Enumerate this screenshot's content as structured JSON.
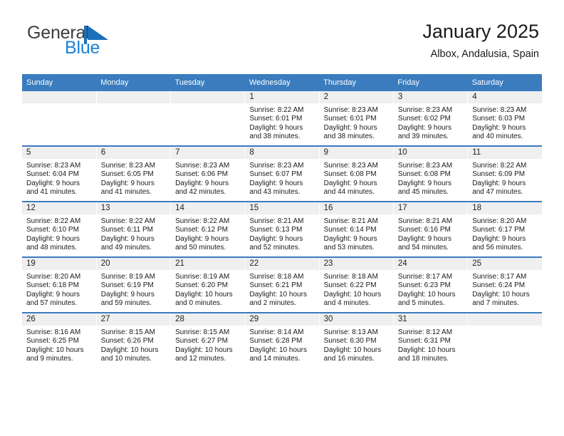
{
  "brand": {
    "name_part1": "General",
    "name_part2": "Blue",
    "flag_icon": "blue-flag-triangle",
    "accent_color": "#1c7fd4"
  },
  "header": {
    "title": "January 2025",
    "location": "Albox, Andalusia, Spain"
  },
  "theme": {
    "header_row_color": "#3a7cbe",
    "daynum_band_color": "#efefef",
    "text_color": "#1a1a1a"
  },
  "weekday_headers": [
    "Sunday",
    "Monday",
    "Tuesday",
    "Wednesday",
    "Thursday",
    "Friday",
    "Saturday"
  ],
  "weeks": [
    [
      {
        "day": "",
        "empty": true,
        "sunrise": "",
        "sunset": "",
        "daylight_line1": "",
        "daylight_line2": ""
      },
      {
        "day": "",
        "empty": true,
        "sunrise": "",
        "sunset": "",
        "daylight_line1": "",
        "daylight_line2": ""
      },
      {
        "day": "",
        "empty": true,
        "sunrise": "",
        "sunset": "",
        "daylight_line1": "",
        "daylight_line2": ""
      },
      {
        "day": "1",
        "empty": false,
        "sunrise": "Sunrise: 8:22 AM",
        "sunset": "Sunset: 6:01 PM",
        "daylight_line1": "Daylight: 9 hours",
        "daylight_line2": "and 38 minutes."
      },
      {
        "day": "2",
        "empty": false,
        "sunrise": "Sunrise: 8:23 AM",
        "sunset": "Sunset: 6:01 PM",
        "daylight_line1": "Daylight: 9 hours",
        "daylight_line2": "and 38 minutes."
      },
      {
        "day": "3",
        "empty": false,
        "sunrise": "Sunrise: 8:23 AM",
        "sunset": "Sunset: 6:02 PM",
        "daylight_line1": "Daylight: 9 hours",
        "daylight_line2": "and 39 minutes."
      },
      {
        "day": "4",
        "empty": false,
        "sunrise": "Sunrise: 8:23 AM",
        "sunset": "Sunset: 6:03 PM",
        "daylight_line1": "Daylight: 9 hours",
        "daylight_line2": "and 40 minutes."
      }
    ],
    [
      {
        "day": "5",
        "empty": false,
        "sunrise": "Sunrise: 8:23 AM",
        "sunset": "Sunset: 6:04 PM",
        "daylight_line1": "Daylight: 9 hours",
        "daylight_line2": "and 41 minutes."
      },
      {
        "day": "6",
        "empty": false,
        "sunrise": "Sunrise: 8:23 AM",
        "sunset": "Sunset: 6:05 PM",
        "daylight_line1": "Daylight: 9 hours",
        "daylight_line2": "and 41 minutes."
      },
      {
        "day": "7",
        "empty": false,
        "sunrise": "Sunrise: 8:23 AM",
        "sunset": "Sunset: 6:06 PM",
        "daylight_line1": "Daylight: 9 hours",
        "daylight_line2": "and 42 minutes."
      },
      {
        "day": "8",
        "empty": false,
        "sunrise": "Sunrise: 8:23 AM",
        "sunset": "Sunset: 6:07 PM",
        "daylight_line1": "Daylight: 9 hours",
        "daylight_line2": "and 43 minutes."
      },
      {
        "day": "9",
        "empty": false,
        "sunrise": "Sunrise: 8:23 AM",
        "sunset": "Sunset: 6:08 PM",
        "daylight_line1": "Daylight: 9 hours",
        "daylight_line2": "and 44 minutes."
      },
      {
        "day": "10",
        "empty": false,
        "sunrise": "Sunrise: 8:23 AM",
        "sunset": "Sunset: 6:08 PM",
        "daylight_line1": "Daylight: 9 hours",
        "daylight_line2": "and 45 minutes."
      },
      {
        "day": "11",
        "empty": false,
        "sunrise": "Sunrise: 8:22 AM",
        "sunset": "Sunset: 6:09 PM",
        "daylight_line1": "Daylight: 9 hours",
        "daylight_line2": "and 47 minutes."
      }
    ],
    [
      {
        "day": "12",
        "empty": false,
        "sunrise": "Sunrise: 8:22 AM",
        "sunset": "Sunset: 6:10 PM",
        "daylight_line1": "Daylight: 9 hours",
        "daylight_line2": "and 48 minutes."
      },
      {
        "day": "13",
        "empty": false,
        "sunrise": "Sunrise: 8:22 AM",
        "sunset": "Sunset: 6:11 PM",
        "daylight_line1": "Daylight: 9 hours",
        "daylight_line2": "and 49 minutes."
      },
      {
        "day": "14",
        "empty": false,
        "sunrise": "Sunrise: 8:22 AM",
        "sunset": "Sunset: 6:12 PM",
        "daylight_line1": "Daylight: 9 hours",
        "daylight_line2": "and 50 minutes."
      },
      {
        "day": "15",
        "empty": false,
        "sunrise": "Sunrise: 8:21 AM",
        "sunset": "Sunset: 6:13 PM",
        "daylight_line1": "Daylight: 9 hours",
        "daylight_line2": "and 52 minutes."
      },
      {
        "day": "16",
        "empty": false,
        "sunrise": "Sunrise: 8:21 AM",
        "sunset": "Sunset: 6:14 PM",
        "daylight_line1": "Daylight: 9 hours",
        "daylight_line2": "and 53 minutes."
      },
      {
        "day": "17",
        "empty": false,
        "sunrise": "Sunrise: 8:21 AM",
        "sunset": "Sunset: 6:16 PM",
        "daylight_line1": "Daylight: 9 hours",
        "daylight_line2": "and 54 minutes."
      },
      {
        "day": "18",
        "empty": false,
        "sunrise": "Sunrise: 8:20 AM",
        "sunset": "Sunset: 6:17 PM",
        "daylight_line1": "Daylight: 9 hours",
        "daylight_line2": "and 56 minutes."
      }
    ],
    [
      {
        "day": "19",
        "empty": false,
        "sunrise": "Sunrise: 8:20 AM",
        "sunset": "Sunset: 6:18 PM",
        "daylight_line1": "Daylight: 9 hours",
        "daylight_line2": "and 57 minutes."
      },
      {
        "day": "20",
        "empty": false,
        "sunrise": "Sunrise: 8:19 AM",
        "sunset": "Sunset: 6:19 PM",
        "daylight_line1": "Daylight: 9 hours",
        "daylight_line2": "and 59 minutes."
      },
      {
        "day": "21",
        "empty": false,
        "sunrise": "Sunrise: 8:19 AM",
        "sunset": "Sunset: 6:20 PM",
        "daylight_line1": "Daylight: 10 hours",
        "daylight_line2": "and 0 minutes."
      },
      {
        "day": "22",
        "empty": false,
        "sunrise": "Sunrise: 8:18 AM",
        "sunset": "Sunset: 6:21 PM",
        "daylight_line1": "Daylight: 10 hours",
        "daylight_line2": "and 2 minutes."
      },
      {
        "day": "23",
        "empty": false,
        "sunrise": "Sunrise: 8:18 AM",
        "sunset": "Sunset: 6:22 PM",
        "daylight_line1": "Daylight: 10 hours",
        "daylight_line2": "and 4 minutes."
      },
      {
        "day": "24",
        "empty": false,
        "sunrise": "Sunrise: 8:17 AM",
        "sunset": "Sunset: 6:23 PM",
        "daylight_line1": "Daylight: 10 hours",
        "daylight_line2": "and 5 minutes."
      },
      {
        "day": "25",
        "empty": false,
        "sunrise": "Sunrise: 8:17 AM",
        "sunset": "Sunset: 6:24 PM",
        "daylight_line1": "Daylight: 10 hours",
        "daylight_line2": "and 7 minutes."
      }
    ],
    [
      {
        "day": "26",
        "empty": false,
        "sunrise": "Sunrise: 8:16 AM",
        "sunset": "Sunset: 6:25 PM",
        "daylight_line1": "Daylight: 10 hours",
        "daylight_line2": "and 9 minutes."
      },
      {
        "day": "27",
        "empty": false,
        "sunrise": "Sunrise: 8:15 AM",
        "sunset": "Sunset: 6:26 PM",
        "daylight_line1": "Daylight: 10 hours",
        "daylight_line2": "and 10 minutes."
      },
      {
        "day": "28",
        "empty": false,
        "sunrise": "Sunrise: 8:15 AM",
        "sunset": "Sunset: 6:27 PM",
        "daylight_line1": "Daylight: 10 hours",
        "daylight_line2": "and 12 minutes."
      },
      {
        "day": "29",
        "empty": false,
        "sunrise": "Sunrise: 8:14 AM",
        "sunset": "Sunset: 6:28 PM",
        "daylight_line1": "Daylight: 10 hours",
        "daylight_line2": "and 14 minutes."
      },
      {
        "day": "30",
        "empty": false,
        "sunrise": "Sunrise: 8:13 AM",
        "sunset": "Sunset: 6:30 PM",
        "daylight_line1": "Daylight: 10 hours",
        "daylight_line2": "and 16 minutes."
      },
      {
        "day": "31",
        "empty": false,
        "sunrise": "Sunrise: 8:12 AM",
        "sunset": "Sunset: 6:31 PM",
        "daylight_line1": "Daylight: 10 hours",
        "daylight_line2": "and 18 minutes."
      },
      {
        "day": "",
        "empty": true,
        "sunrise": "",
        "sunset": "",
        "daylight_line1": "",
        "daylight_line2": ""
      }
    ]
  ]
}
